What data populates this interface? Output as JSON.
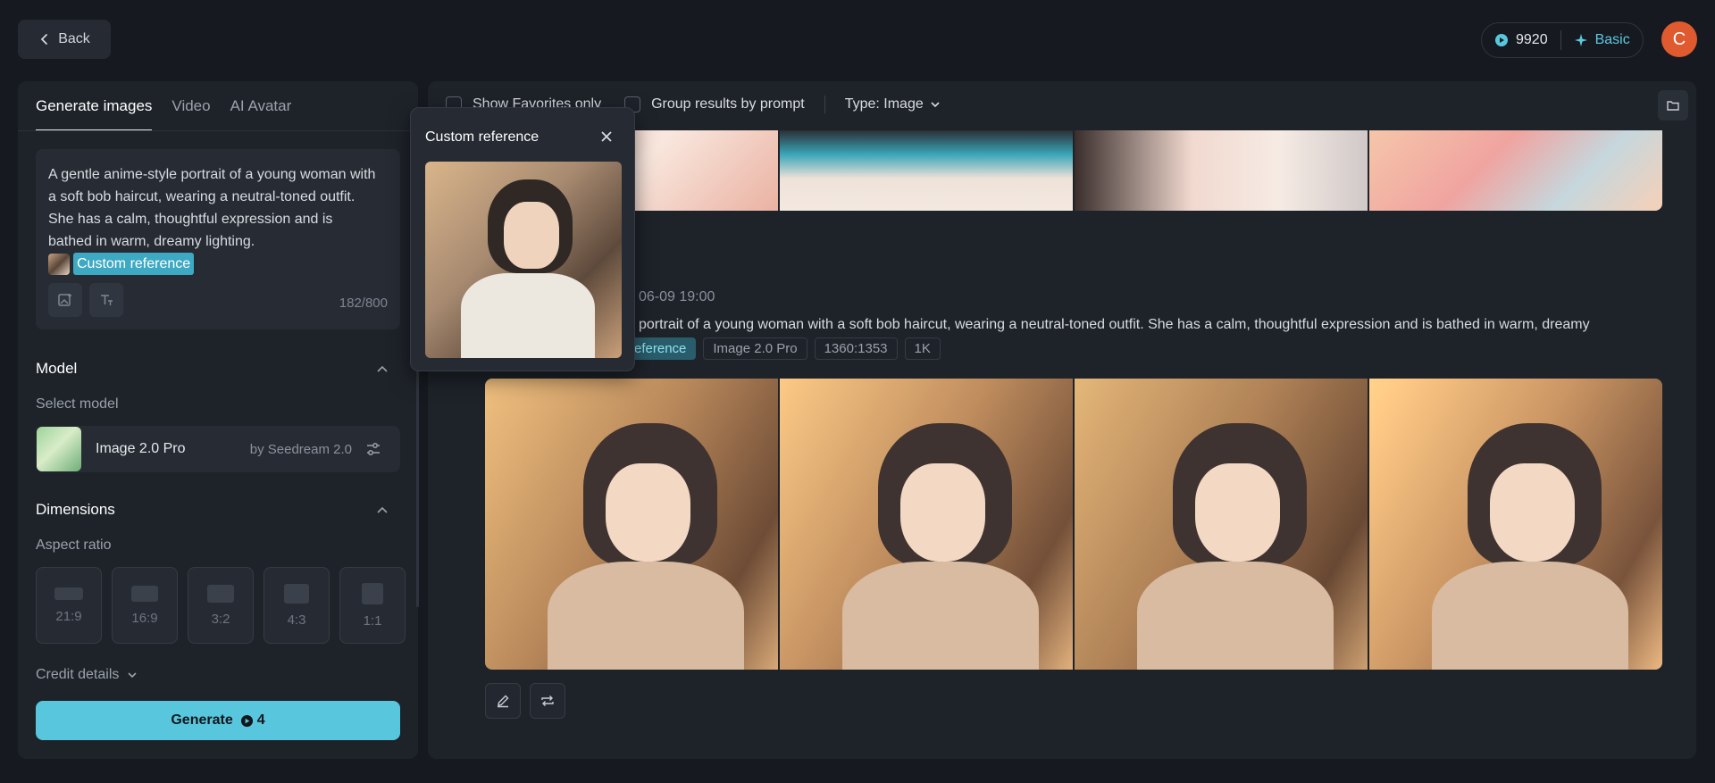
{
  "header": {
    "back_label": "Back",
    "credits": "9920",
    "plan": "Basic",
    "avatar_initial": "C"
  },
  "left_panel": {
    "tabs": [
      {
        "label": "Generate images",
        "active": true
      },
      {
        "label": "Video",
        "active": false
      },
      {
        "label": "AI Avatar",
        "active": false
      }
    ],
    "prompt": {
      "text": "A gentle anime-style portrait of a young woman with a soft bob haircut, wearing a neutral-toned outfit. She has a calm, thoughtful expression and is bathed in warm, dreamy lighting.",
      "reference_label": "Custom reference",
      "char_count": "182/800"
    },
    "model_section": {
      "title": "Model",
      "select_label": "Select model",
      "model_name": "Image 2.0 Pro",
      "model_by": "by Seedream 2.0"
    },
    "dimensions_section": {
      "title": "Dimensions",
      "aspect_label": "Aspect ratio",
      "ratios": [
        "21:9",
        "16:9",
        "3:2",
        "4:3",
        "1:1"
      ]
    },
    "credit_details_label": "Credit details",
    "generate_label": "Generate",
    "generate_cost": "4"
  },
  "right_panel": {
    "filters": {
      "favorites_label": "Show Favorites only",
      "group_label": "Group results by prompt",
      "type_label": "Type: Image"
    },
    "result": {
      "date": "06-09  19:00",
      "prompt_visible": "portrait of a young woman with a soft bob haircut, wearing a neutral-toned outfit. She has a calm, thoughtful expression and is bathed in warm, dreamy",
      "tags": [
        "eference",
        "Image 2.0 Pro",
        "1360:1353",
        "1K"
      ]
    }
  },
  "popup": {
    "title": "Custom reference"
  },
  "colors": {
    "accent": "#58c7de",
    "background": "#161a20",
    "panel": "#1e232a",
    "avatar": "#e05a2f"
  }
}
